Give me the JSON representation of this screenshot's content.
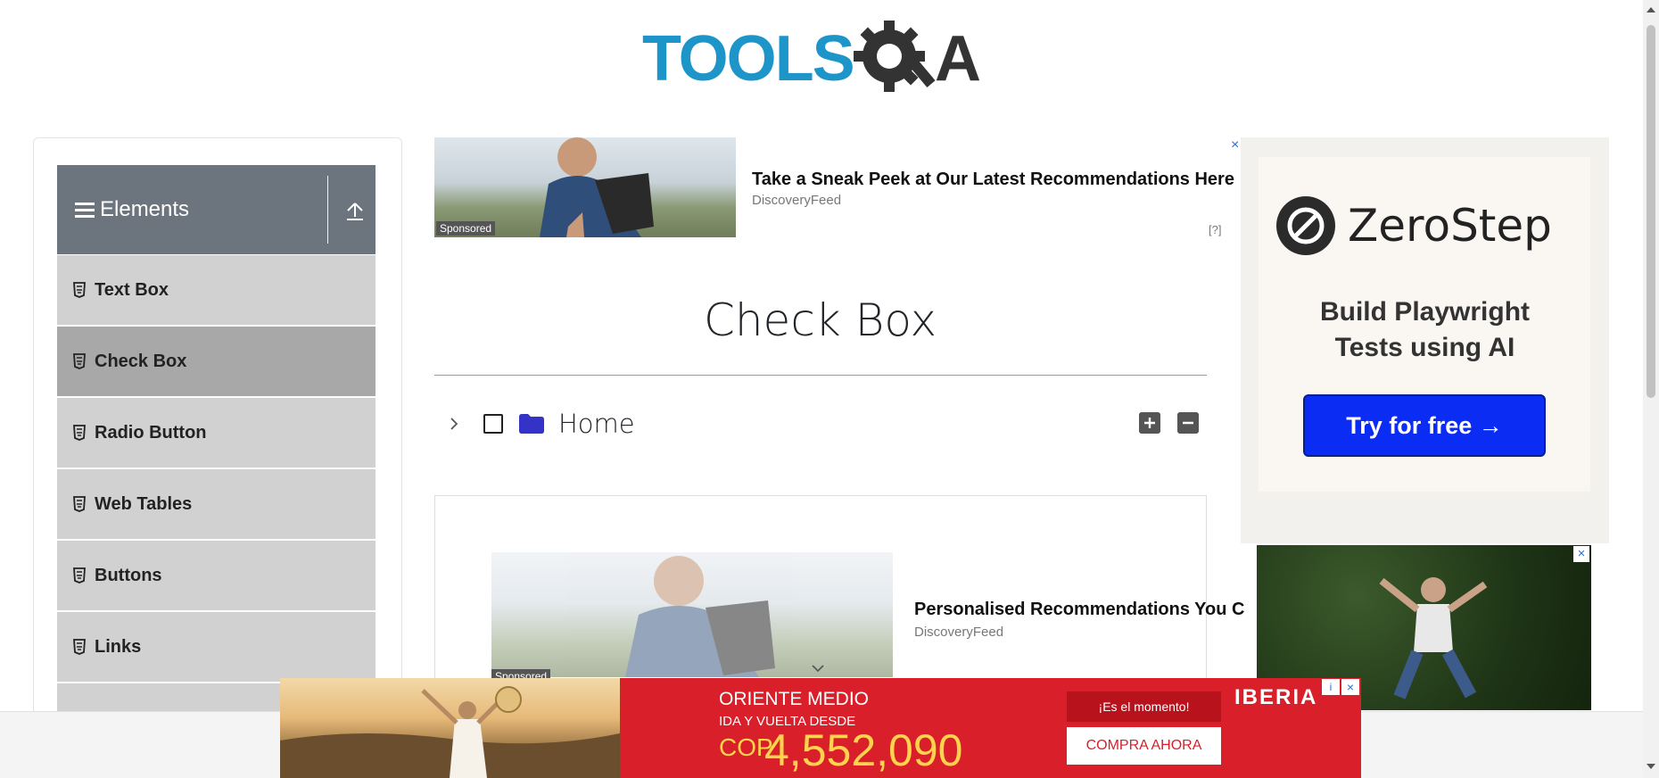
{
  "logo": {
    "text_left": "TOOLS",
    "text_right": "A"
  },
  "sidebar": {
    "group_title": "Elements",
    "items": [
      {
        "label": "Text Box"
      },
      {
        "label": "Check Box"
      },
      {
        "label": "Radio Button"
      },
      {
        "label": "Web Tables"
      },
      {
        "label": "Buttons"
      },
      {
        "label": "Links"
      }
    ]
  },
  "top_ad": {
    "sponsored": "Sponsored",
    "headline": "Take a Sneak Peek at Our Latest Recommendations Here",
    "source": "DiscoveryFeed",
    "info": "[?]",
    "close": "×"
  },
  "main": {
    "title": "Check Box",
    "tree": {
      "root_label": "Home"
    }
  },
  "mid_ad": {
    "headline": "Personalised Recommendations You C",
    "source": "DiscoveryFeed",
    "sponsored": "Sponsored"
  },
  "right_ad": {
    "brand": "ZeroStep",
    "tagline_1": "Build Playwright",
    "tagline_2": "Tests using AI",
    "cta": "Try for free →",
    "close": "×"
  },
  "iberia_ad": {
    "destination": "ORIENTE MEDIO",
    "subtitle": "IDA Y VUELTA DESDE",
    "currency": "COP",
    "price": "4,552,090",
    "moment": "¡Es el momento!",
    "cta": "COMPRA AHORA",
    "brand": "IBERIA",
    "close": "×",
    "info": "i"
  },
  "colors": {
    "logo_blue": "#1d95c9",
    "logo_dark": "#333333",
    "sidebar_header": "#6c757d",
    "menu_item": "#d1d1d1",
    "menu_active": "#a8a8a8",
    "zerostep_button": "#0a2cf3",
    "iberia_red": "#d81f2a"
  }
}
